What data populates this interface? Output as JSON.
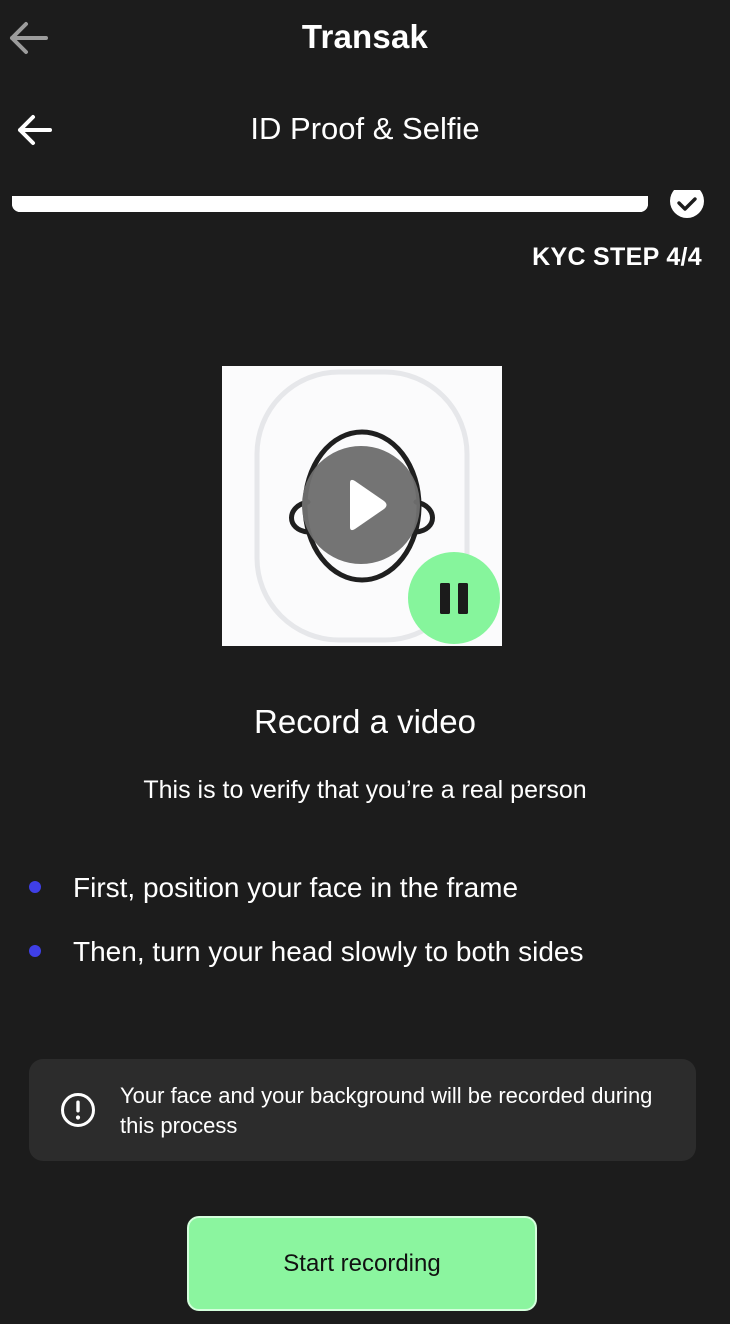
{
  "topbar": {
    "title": "Transak",
    "back_icon": "arrow-left-icon"
  },
  "header": {
    "title": "ID Proof & Selfie",
    "back_icon": "arrow-left-icon"
  },
  "progress": {
    "fraction": 1.0,
    "step_label": "KYC STEP 4/4",
    "check_icon": "check-circle-icon"
  },
  "preview": {
    "face_icon": "face-outline-icon",
    "play_icon": "play-icon",
    "pause_icon": "pause-icon",
    "pause_color": "#86f59c"
  },
  "content": {
    "heading": "Record a video",
    "subheading": "This is to verify that you’re a real person",
    "instructions": [
      "First, position your face in the frame",
      "Then, turn your head slowly to both sides"
    ]
  },
  "notice": {
    "icon": "exclamation-circle-icon",
    "text": "Your face and your background will be recorded during this process"
  },
  "actions": {
    "start_label": "Start recording"
  },
  "colors": {
    "background": "#1c1c1c",
    "accent_green": "#8bf59f",
    "bullet_blue": "#3f3fe6",
    "notice_bg": "#2c2c2c"
  }
}
